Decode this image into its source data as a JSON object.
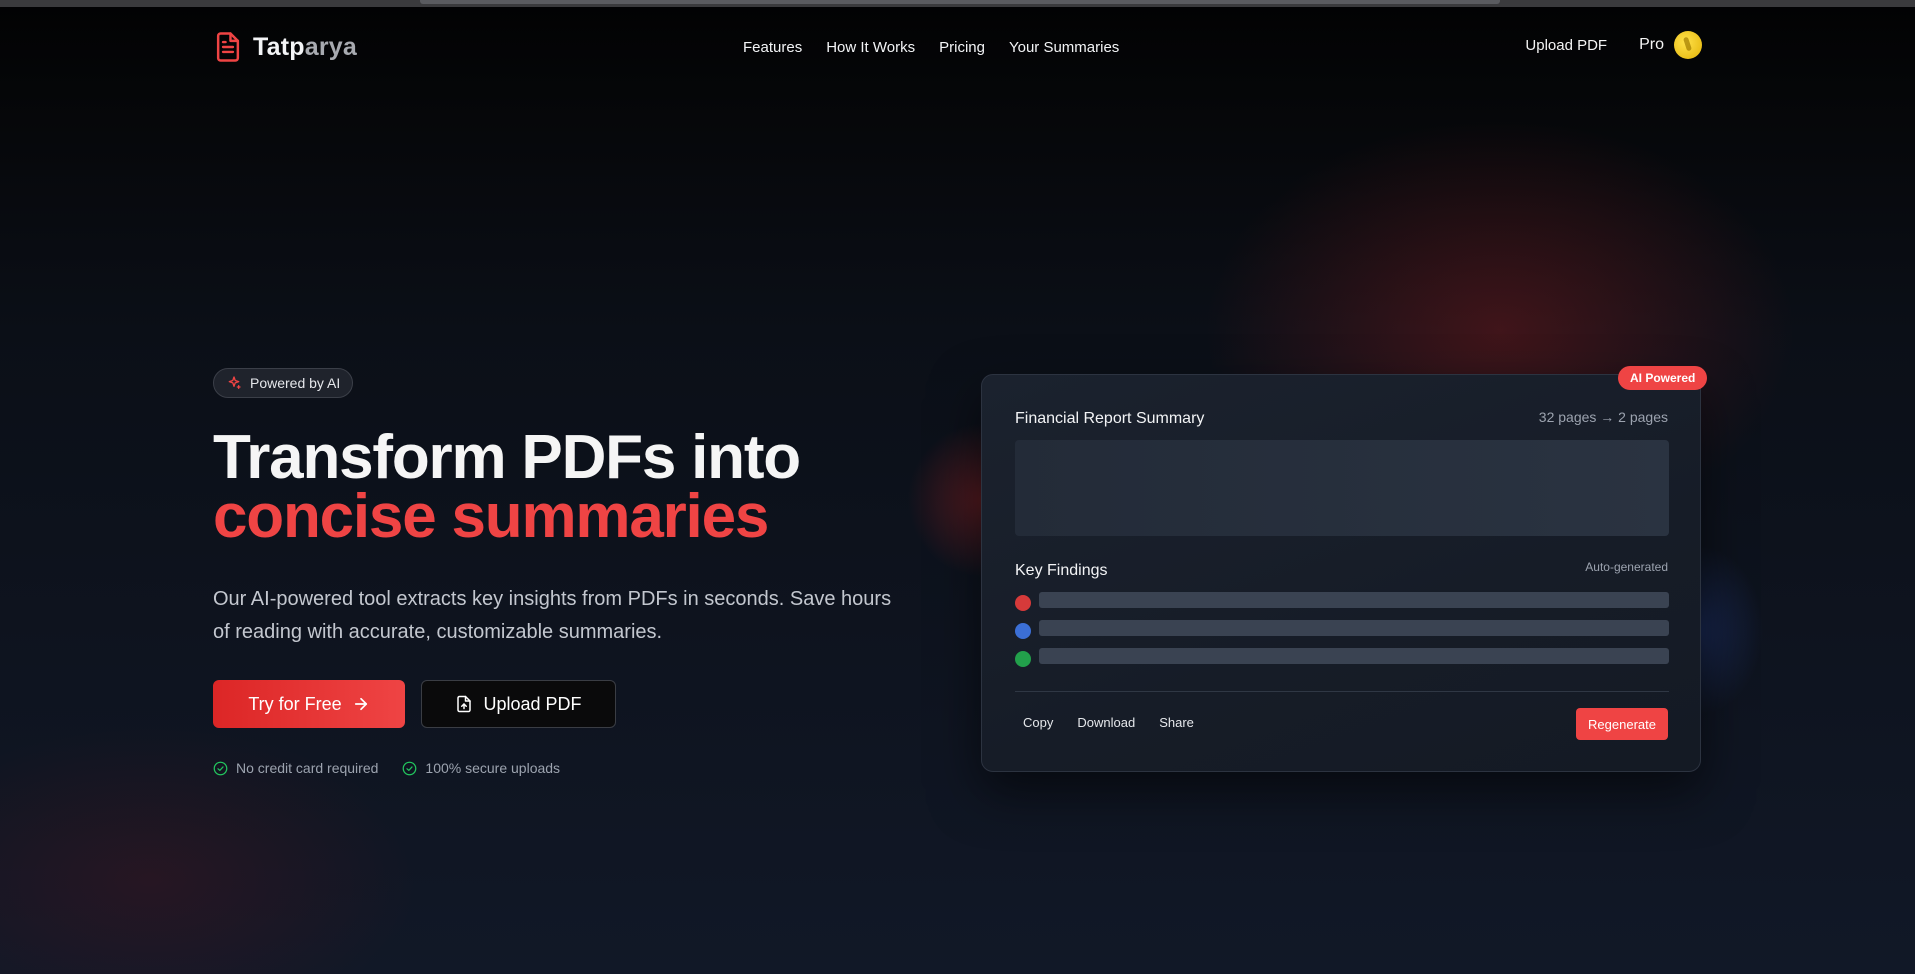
{
  "brand": {
    "name_part1": "Tatp",
    "name_part2": "arya"
  },
  "nav": {
    "links": [
      "Features",
      "How It Works",
      "Pricing",
      "Your Summaries"
    ],
    "upload_label": "Upload PDF",
    "pro_label": "Pro"
  },
  "hero": {
    "badge": "Powered by AI",
    "headline_line1": "Transform PDFs into",
    "headline_line2": "concise summaries",
    "lead": "Our AI-powered tool extracts key insights from PDFs in seconds. Save hours of reading with accurate, customizable summaries.",
    "cta_primary": "Try for Free",
    "cta_secondary": "Upload PDF",
    "checks": [
      "No credit card required",
      "100% secure uploads"
    ]
  },
  "card": {
    "tag": "AI Powered",
    "title": "Financial Report Summary",
    "pages": "32 pages → 2 pages",
    "findings_title": "Key Findings",
    "findings_meta": "Auto-generated",
    "finding_colors": [
      "#d63a3a",
      "#3b6fd6",
      "#22a04b"
    ],
    "actions": [
      "Copy",
      "Download",
      "Share"
    ],
    "regenerate": "Regenerate"
  },
  "colors": {
    "accent": "#ef4444",
    "success": "#22c55e"
  }
}
